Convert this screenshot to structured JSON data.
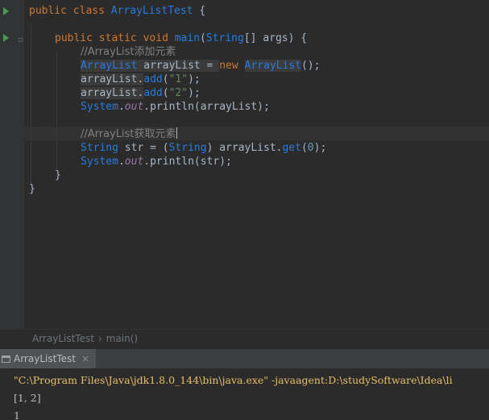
{
  "editor": {
    "lines": {
      "class_decl": {
        "kw1": "public",
        "kw2": "class",
        "name": "ArrayListTest",
        "brace": "{"
      },
      "main_decl": {
        "kw1": "public",
        "kw2": "static",
        "kw3": "void",
        "name": "main",
        "type": "String",
        "rest": "[] args) {"
      },
      "comment1": "//ArrayList添加元素",
      "decl_list": {
        "type": "ArrayList",
        "var": " arrayList = ",
        "kw": "new",
        "ctor": "ArrayList",
        "end": "();"
      },
      "add1": {
        "obj": "arrayList.",
        "method": "add",
        "open": "(",
        "arg": "\"1\"",
        "close": ");"
      },
      "add2": {
        "obj": "arrayList.",
        "method": "add",
        "open": "(",
        "arg": "\"2\"",
        "close": ");"
      },
      "print1": {
        "cls": "System",
        "dot1": ".",
        "field": "out",
        "dot2": ".",
        "method": "println",
        "args": "(arrayList);"
      },
      "comment2": "//ArrayList获取元素",
      "get_line": {
        "type": "String",
        "mid": " str = (",
        "cast": "String",
        "call": ") arrayList.",
        "method": "get",
        "open": "(",
        "num": "0",
        "close": ");"
      },
      "print2": {
        "cls": "System",
        "dot1": ".",
        "field": "out",
        "dot2": ".",
        "method": "println",
        "args": "(str);"
      },
      "close_main": "}",
      "close_class": "}"
    }
  },
  "breadcrumb": {
    "class": "ArrayListTest",
    "separator": "›",
    "method": "main()"
  },
  "run_panel": {
    "tab_label": "ArrayListTest",
    "close_glyph": "×",
    "console": [
      "\"C:\\Program Files\\Java\\jdk1.8.0_144\\bin\\java.exe\" -javaagent:D:\\studySoftware\\Idea\\li",
      "[1, 2]",
      "1"
    ]
  },
  "colors": {
    "editor_bg": "#2b2b2b",
    "keyword": "#cc7832",
    "class_ref": "#287bde",
    "string": "#6a8759",
    "number": "#6897bb",
    "comment": "#808080",
    "console_cmd": "#e8bf6a"
  },
  "icons": [
    "run-gutter-icon",
    "fold-marker-icon",
    "run-console-icon",
    "close-icon"
  ]
}
